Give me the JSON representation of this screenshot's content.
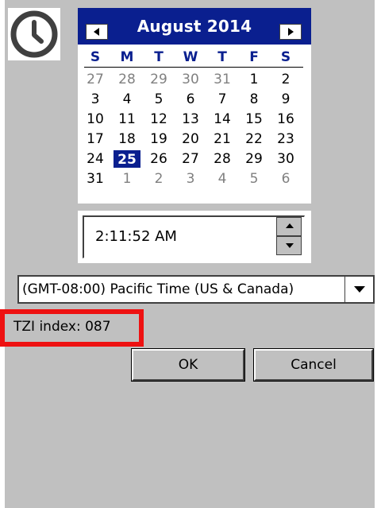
{
  "calendar": {
    "month_title": "August 2014",
    "weekdays": [
      "S",
      "M",
      "T",
      "W",
      "T",
      "F",
      "S"
    ],
    "weeks": [
      [
        {
          "d": "27",
          "out": true
        },
        {
          "d": "28",
          "out": true
        },
        {
          "d": "29",
          "out": true
        },
        {
          "d": "30",
          "out": true
        },
        {
          "d": "31",
          "out": true
        },
        {
          "d": "1"
        },
        {
          "d": "2"
        }
      ],
      [
        {
          "d": "3"
        },
        {
          "d": "4"
        },
        {
          "d": "5"
        },
        {
          "d": "6"
        },
        {
          "d": "7"
        },
        {
          "d": "8"
        },
        {
          "d": "9"
        }
      ],
      [
        {
          "d": "10"
        },
        {
          "d": "11"
        },
        {
          "d": "12"
        },
        {
          "d": "13"
        },
        {
          "d": "14"
        },
        {
          "d": "15"
        },
        {
          "d": "16"
        }
      ],
      [
        {
          "d": "17"
        },
        {
          "d": "18"
        },
        {
          "d": "19"
        },
        {
          "d": "20"
        },
        {
          "d": "21"
        },
        {
          "d": "22"
        },
        {
          "d": "23"
        }
      ],
      [
        {
          "d": "24"
        },
        {
          "d": "25",
          "sel": true
        },
        {
          "d": "26"
        },
        {
          "d": "27"
        },
        {
          "d": "28"
        },
        {
          "d": "29"
        },
        {
          "d": "30"
        }
      ],
      [
        {
          "d": "31"
        },
        {
          "d": "1",
          "out": true
        },
        {
          "d": "2",
          "out": true
        },
        {
          "d": "3",
          "out": true
        },
        {
          "d": "4",
          "out": true
        },
        {
          "d": "5",
          "out": true
        },
        {
          "d": "6",
          "out": true
        }
      ]
    ],
    "selected_day": "25",
    "header_color": "#0a1f8f"
  },
  "time": {
    "value": "2:11:52 AM"
  },
  "timezone": {
    "selected": "(GMT-08:00) Pacific Time (US & Canada)"
  },
  "tzi": {
    "label": "TZI index: 087",
    "highlight_color": "#ee1111"
  },
  "buttons": {
    "ok_label": "OK",
    "cancel_label": "Cancel"
  },
  "icons": {
    "clock": "clock-icon",
    "prev": "arrow-left-icon",
    "next": "arrow-right-icon",
    "spin_up": "arrow-up-icon",
    "spin_down": "arrow-down-icon",
    "dropdown": "chevron-down-icon"
  }
}
